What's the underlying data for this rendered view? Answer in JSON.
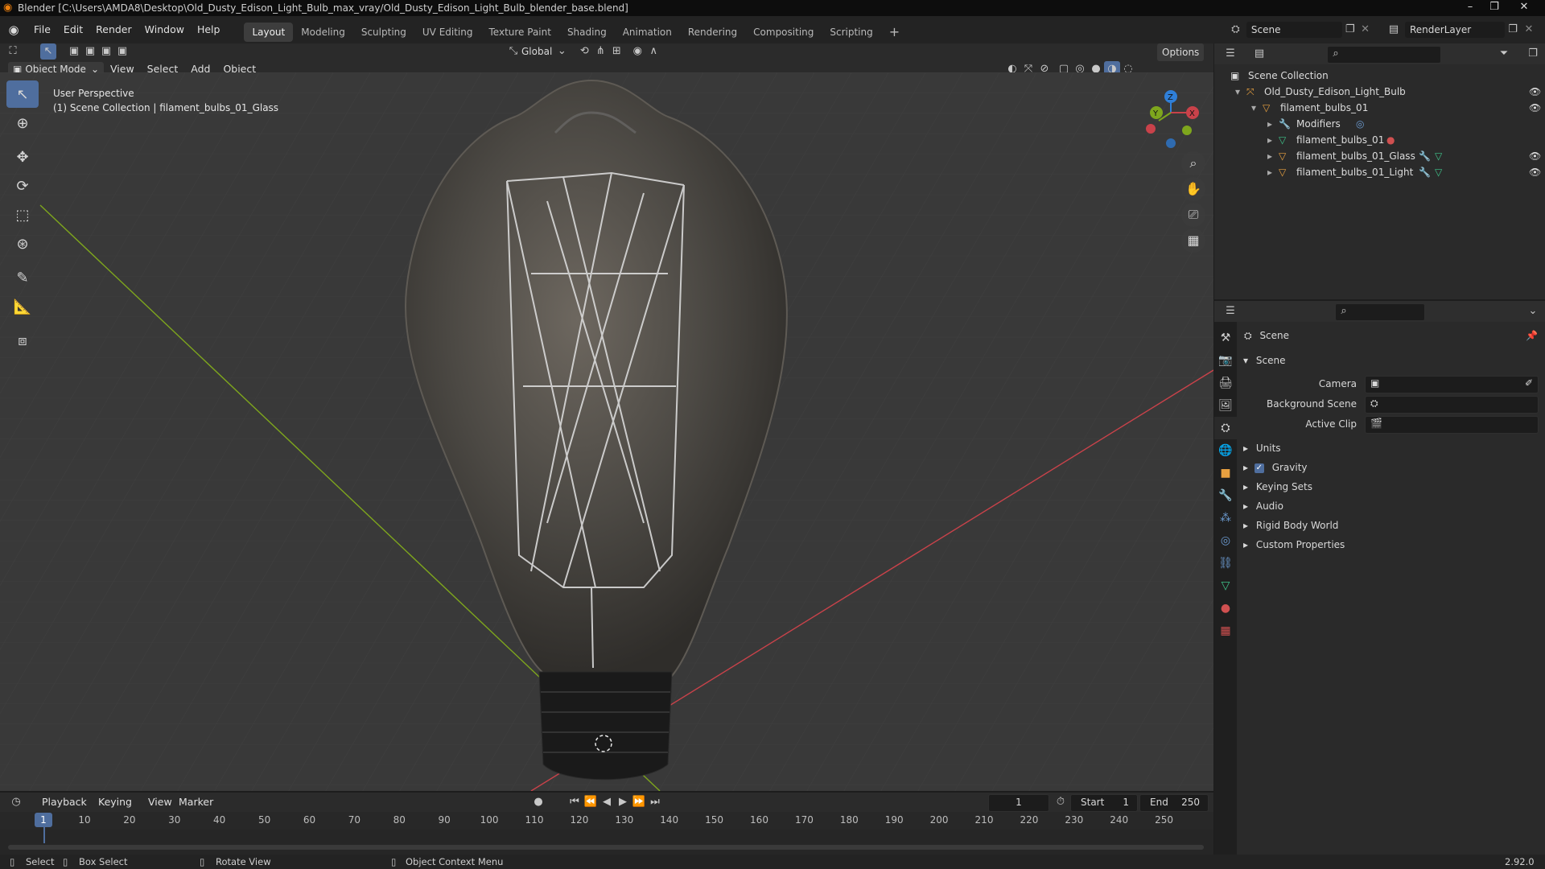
{
  "window": {
    "title": "Blender [C:\\Users\\AMDA8\\Desktop\\Old_Dusty_Edison_Light_Bulb_max_vray/Old_Dusty_Edison_Light_Bulb_blender_base.blend]"
  },
  "menu": [
    "File",
    "Edit",
    "Render",
    "Window",
    "Help"
  ],
  "workspaces": [
    "Layout",
    "Modeling",
    "Sculpting",
    "UV Editing",
    "Texture Paint",
    "Shading",
    "Animation",
    "Rendering",
    "Compositing",
    "Scripting"
  ],
  "scene_name": "Scene",
  "render_layer": "RenderLayer",
  "viewport_header": {
    "mode": "Object Mode",
    "items": [
      "View",
      "Select",
      "Add",
      "Object"
    ],
    "orientation": "Global",
    "options": "Options"
  },
  "viewport": {
    "perspective": "User Perspective",
    "collection_info": "(1) Scene Collection | filament_bulbs_01_Glass",
    "gizmo": {
      "x": "X",
      "y": "Y",
      "z": "Z"
    }
  },
  "outliner": {
    "root": "Scene Collection",
    "items": [
      {
        "label": "Old_Dusty_Edison_Light_Bulb",
        "level": 1
      },
      {
        "label": "filament_bulbs_01",
        "level": 2
      },
      {
        "label": "Modifiers",
        "level": 3
      },
      {
        "label": "filament_bulbs_01",
        "level": 3
      },
      {
        "label": "filament_bulbs_01_Glass",
        "level": 3
      },
      {
        "label": "filament_bulbs_01_Light",
        "level": 3
      }
    ]
  },
  "properties": {
    "breadcrumb": "Scene",
    "panel_title": "Scene",
    "fields": {
      "camera": "Camera",
      "background_scene": "Background Scene",
      "active_clip": "Active Clip"
    },
    "sections": [
      "Units",
      "Gravity",
      "Keying Sets",
      "Audio",
      "Rigid Body World",
      "Custom Properties"
    ]
  },
  "timeline": {
    "menus": [
      "Playback",
      "Keying",
      "View",
      "Marker"
    ],
    "current_frame": "1",
    "start_label": "Start",
    "start": "1",
    "end_label": "End",
    "end": "250",
    "ticks": [
      "1",
      "10",
      "20",
      "30",
      "40",
      "50",
      "60",
      "70",
      "80",
      "90",
      "100",
      "110",
      "120",
      "130",
      "140",
      "150",
      "160",
      "170",
      "180",
      "190",
      "200",
      "210",
      "220",
      "230",
      "240",
      "250"
    ]
  },
  "status": {
    "select": "Select",
    "box_select": "Box Select",
    "rotate_view": "Rotate View",
    "context_menu": "Object Context Menu",
    "version": "2.92.0"
  },
  "colors": {
    "accent": "#4f6e9e",
    "x_axis": "#c9424a",
    "y_axis": "#7ea61d",
    "z_axis": "#2f7fd8"
  }
}
